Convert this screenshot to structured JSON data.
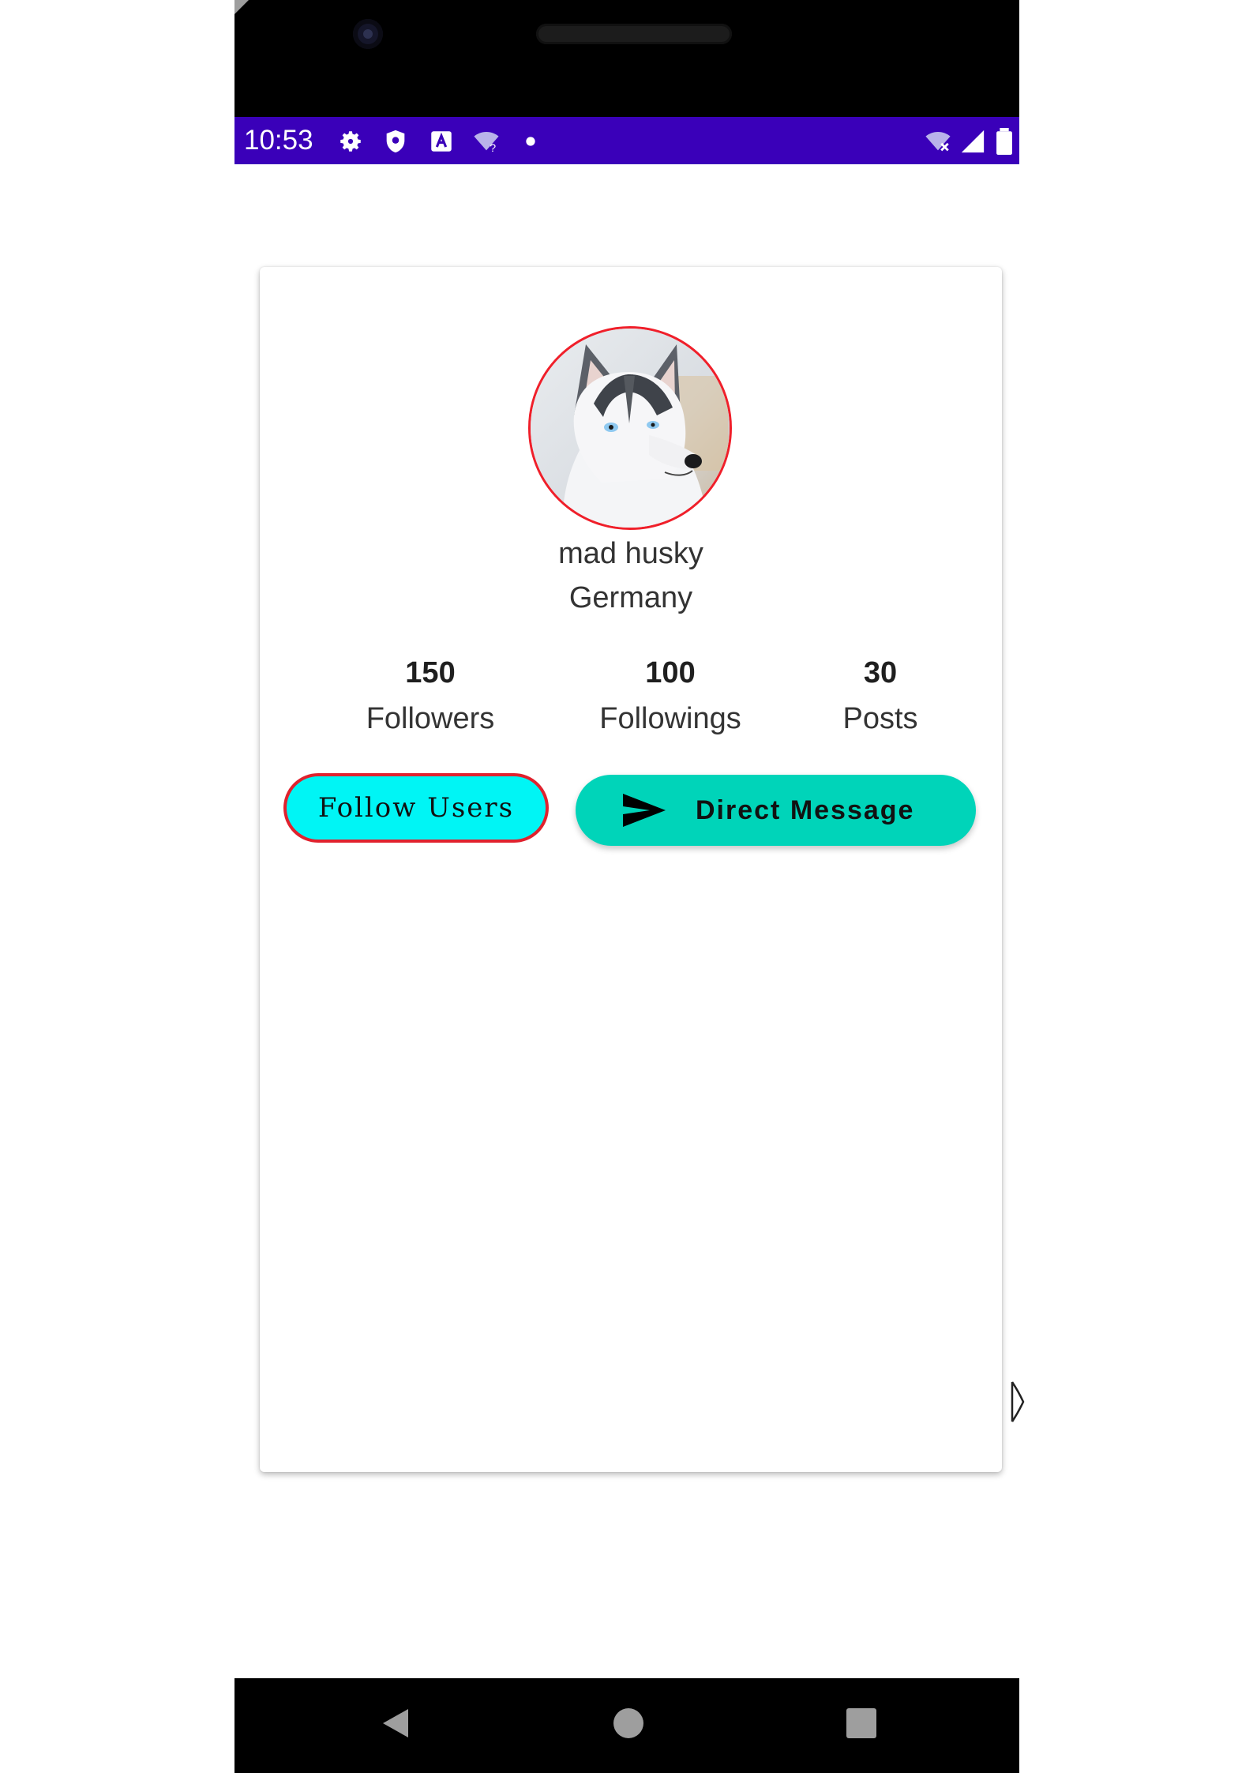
{
  "status_bar": {
    "time": "10:53",
    "left_icons": [
      "settings-icon",
      "shield-icon",
      "a-icon",
      "wifi-question-icon",
      "dot-icon"
    ],
    "right_icons": [
      "wifi-off-icon",
      "signal-icon",
      "battery-icon"
    ],
    "background_color": "#3a00b9"
  },
  "profile": {
    "name": "mad husky",
    "location": "Germany",
    "avatar_border_color": "#f01f2a"
  },
  "stats": [
    {
      "value": "150",
      "label": "Followers"
    },
    {
      "value": "100",
      "label": "Followings"
    },
    {
      "value": "30",
      "label": "Posts"
    }
  ],
  "actions": {
    "follow_label": "Follow Users",
    "follow_color": "#00f5f5",
    "direct_message_label": "Direct Message",
    "direct_message_color": "#00d4b9"
  },
  "navigation": {
    "buttons": [
      "back-icon",
      "home-icon",
      "recents-icon"
    ]
  }
}
